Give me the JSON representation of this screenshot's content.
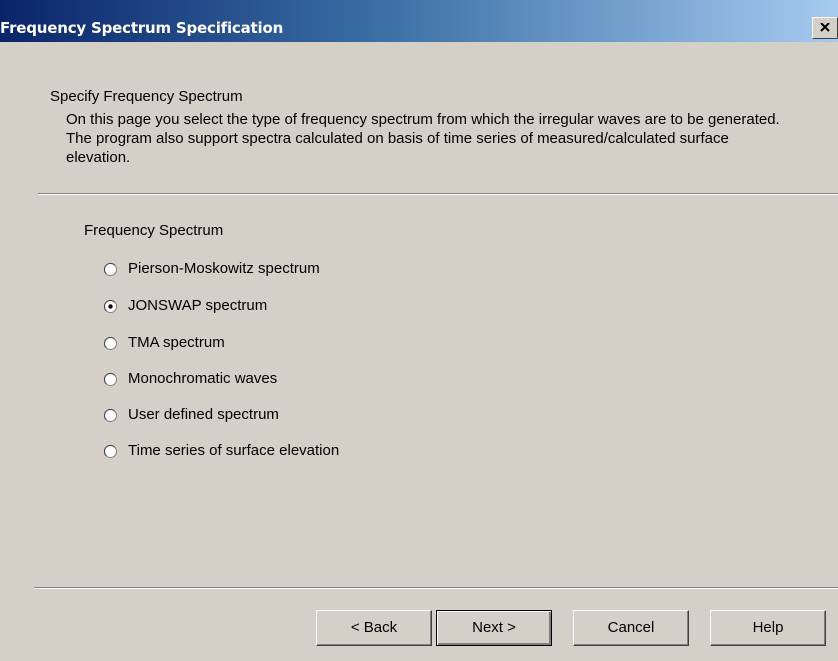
{
  "window": {
    "title": "Frequency Spectrum Specification",
    "close_glyph": "close-icon"
  },
  "header": {
    "title": "Specify Frequency Spectrum",
    "description": "On this page you select the type of frequency spectrum from which the irregular waves are to be generated. The program also support spectra calculated on basis of time series of measured/calculated surface elevation."
  },
  "spectrum_group": {
    "label": "Frequency Spectrum",
    "selected_index": 1,
    "options": [
      {
        "label": "Pierson-Moskowitz spectrum",
        "selected": false
      },
      {
        "label": "JONSWAP spectrum",
        "selected": true
      },
      {
        "label": "TMA spectrum",
        "selected": false
      },
      {
        "label": "Monochromatic waves",
        "selected": false
      },
      {
        "label": "User defined spectrum",
        "selected": false
      },
      {
        "label": "Time series of surface elevation",
        "selected": false
      }
    ]
  },
  "buttons": {
    "back": "< Back",
    "next": "Next >",
    "cancel": "Cancel",
    "help": "Help"
  },
  "colors": {
    "window_bg": "#d4d0c8",
    "titlebar_start": "#0a246a",
    "titlebar_end": "#a6caf0",
    "title_text": "#ffffff"
  }
}
